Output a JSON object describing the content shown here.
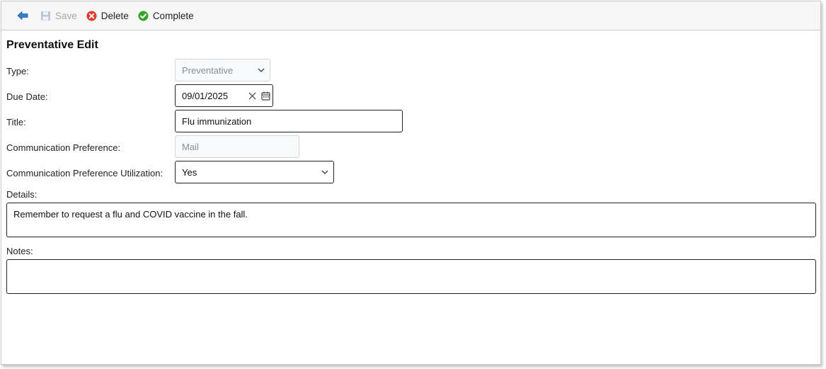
{
  "toolbar": {
    "back_icon": "arrow-left-icon",
    "save_label": "Save",
    "delete_label": "Delete",
    "complete_label": "Complete",
    "colors": {
      "back": "#2f7fd0",
      "delete": "#e23b2e",
      "complete": "#35a42c",
      "disabled": "#a9a9a9"
    }
  },
  "form": {
    "title": "Preventative Edit",
    "type": {
      "label": "Type:",
      "value": "Preventative"
    },
    "due_date": {
      "label": "Due Date:",
      "value": "09/01/2025"
    },
    "title_field": {
      "label": "Title:",
      "value": "Flu immunization"
    },
    "comm_pref": {
      "label": "Communication Preference:",
      "value": "Mail"
    },
    "comm_pref_util": {
      "label": "Communication Preference Utilization:",
      "value": "Yes"
    },
    "details": {
      "label": "Details:",
      "value": "Remember to request a flu and COVID vaccine in the fall."
    },
    "notes": {
      "label": "Notes:",
      "value": ""
    }
  }
}
